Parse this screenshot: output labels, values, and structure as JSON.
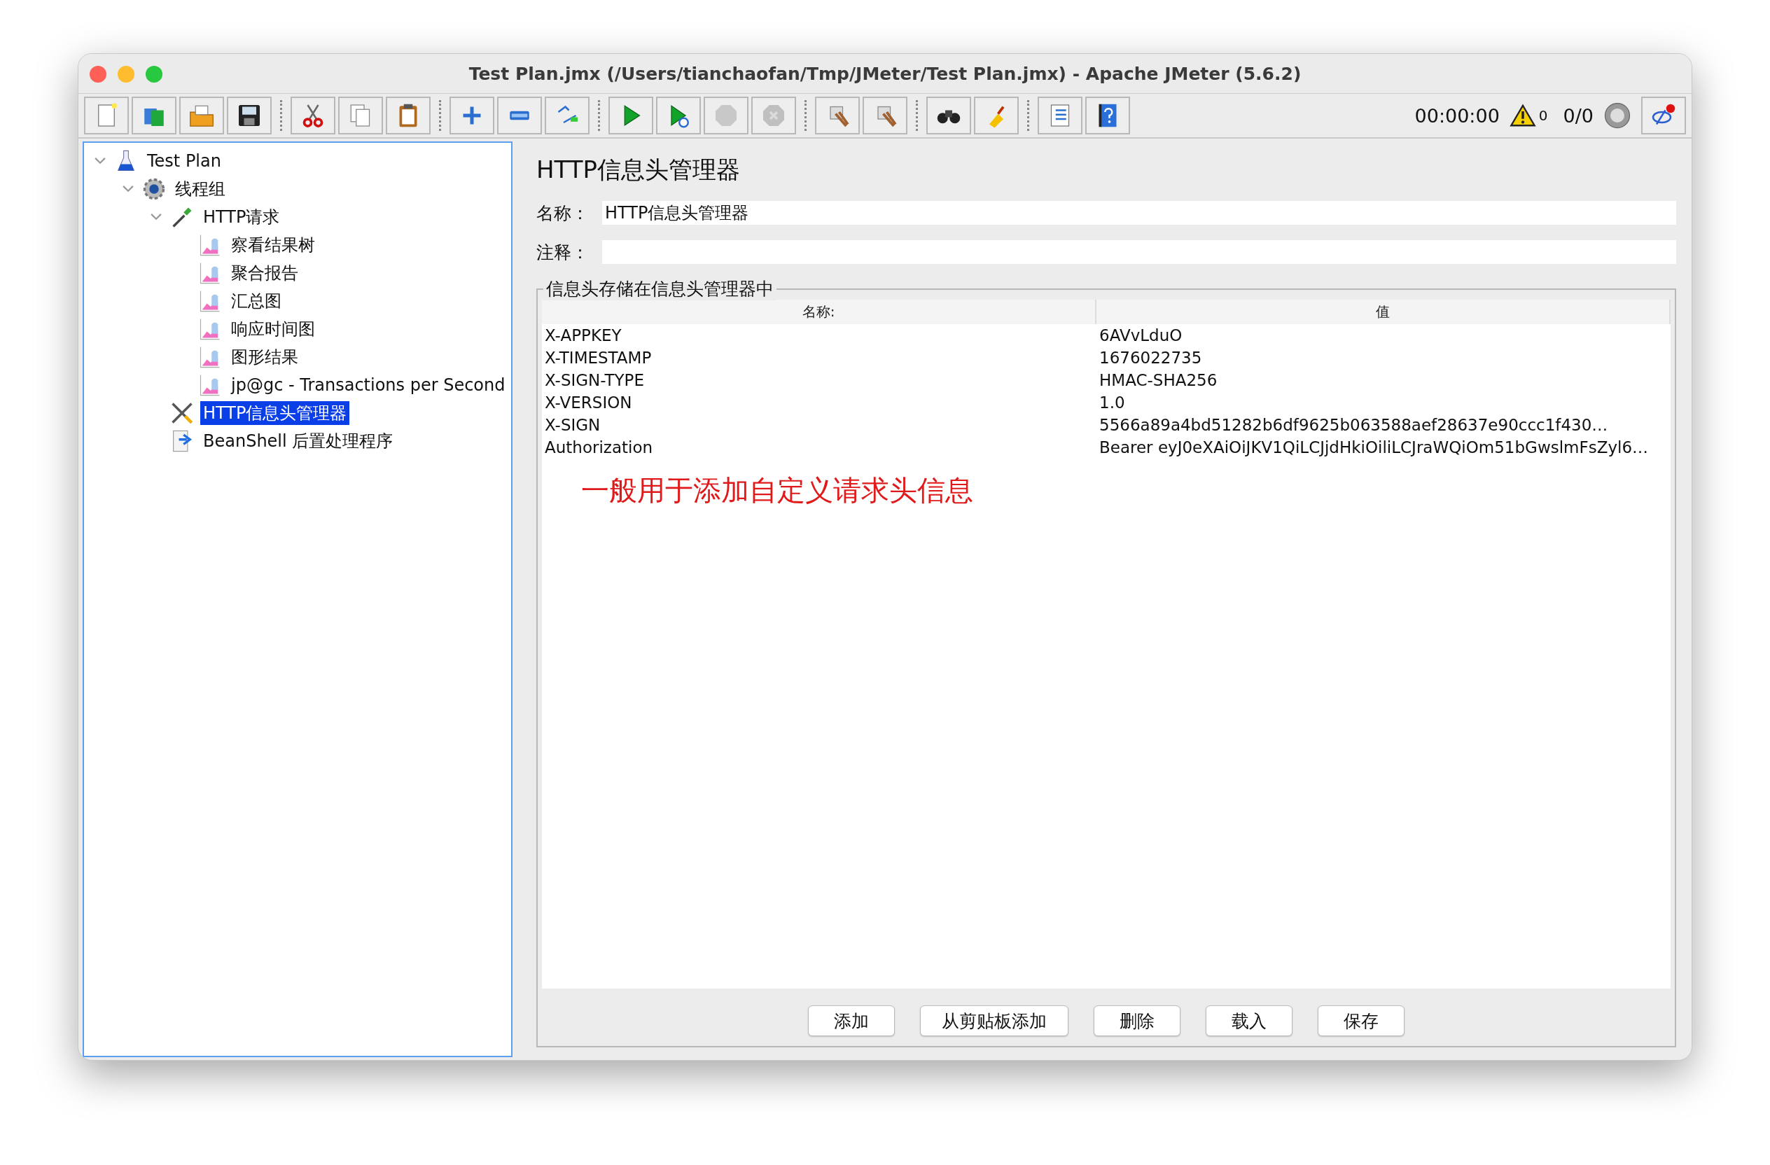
{
  "window": {
    "title": "Test Plan.jmx (/Users/tianchaofan/Tmp/JMeter/Test Plan.jmx) - Apache JMeter (5.6.2)"
  },
  "toolbar": {
    "groups": [
      [
        {
          "kind": "new",
          "disabled": false
        },
        {
          "kind": "templates",
          "disabled": false
        },
        {
          "kind": "open",
          "disabled": false
        },
        {
          "kind": "save",
          "disabled": false
        }
      ],
      [
        {
          "kind": "cut",
          "disabled": false
        },
        {
          "kind": "copy",
          "disabled": false
        },
        {
          "kind": "paste",
          "disabled": false
        }
      ],
      [
        {
          "kind": "expand",
          "disabled": false
        },
        {
          "kind": "collapse",
          "disabled": false
        },
        {
          "kind": "toggle",
          "disabled": false
        }
      ],
      [
        {
          "kind": "start",
          "disabled": false
        },
        {
          "kind": "start-no-timers",
          "disabled": false
        },
        {
          "kind": "stop",
          "disabled": true
        },
        {
          "kind": "shutdown",
          "disabled": true
        }
      ],
      [
        {
          "kind": "clear",
          "disabled": false
        },
        {
          "kind": "clear-all",
          "disabled": false
        }
      ],
      [
        {
          "kind": "search",
          "disabled": false
        },
        {
          "kind": "reset-search",
          "disabled": false
        }
      ],
      [
        {
          "kind": "function-helper",
          "disabled": false
        },
        {
          "kind": "help",
          "disabled": false
        }
      ]
    ],
    "elapsed": "00:00:00",
    "error_count": "0",
    "threads": "0/0"
  },
  "tree": [
    {
      "label": "Test Plan",
      "kind": "test-plan",
      "expanded": true,
      "selected": false,
      "children": [
        {
          "label": "线程组",
          "kind": "thread-group",
          "expanded": true,
          "selected": false,
          "children": [
            {
              "label": "HTTP请求",
              "kind": "sampler",
              "expanded": true,
              "selected": false,
              "children": [
                {
                  "label": "察看结果树",
                  "kind": "listener",
                  "selected": false
                },
                {
                  "label": "聚合报告",
                  "kind": "listener",
                  "selected": false
                },
                {
                  "label": "汇总图",
                  "kind": "listener",
                  "selected": false
                },
                {
                  "label": "响应时间图",
                  "kind": "listener",
                  "selected": false
                },
                {
                  "label": "图形结果",
                  "kind": "listener",
                  "selected": false
                },
                {
                  "label": "jp@gc - Transactions per Second",
                  "kind": "listener",
                  "selected": false
                }
              ]
            },
            {
              "label": "HTTP信息头管理器",
              "kind": "config",
              "selected": true
            },
            {
              "label": "BeanShell 后置处理程序",
              "kind": "postprocessor",
              "selected": false
            }
          ]
        }
      ]
    }
  ],
  "panel": {
    "title": "HTTP信息头管理器",
    "name_label": "名称：",
    "name_value": "HTTP信息头管理器",
    "comment_label": "注释：",
    "group_title": "信息头存储在信息头管理器中",
    "table": {
      "columns": [
        "名称:",
        "值"
      ],
      "rows": [
        [
          "X-APPKEY",
          "6AVvLduO"
        ],
        [
          "X-TIMESTAMP",
          "1676022735"
        ],
        [
          "X-SIGN-TYPE",
          "HMAC-SHA256"
        ],
        [
          "X-VERSION",
          "1.0"
        ],
        [
          "X-SIGN",
          "5566a89a4bd51282b6df9625b063588aef28637e90ccc1f430…"
        ],
        [
          "Authorization",
          "Bearer eyJ0eXAiOiJKV1QiLCJjdHkiOiliLCJraWQiOm51bGwslmFsZyl6…"
        ]
      ]
    },
    "annotation": "一般用于添加自定义请求头信息",
    "buttons": [
      "添加",
      "从剪贴板添加",
      "删除",
      "载入",
      "保存"
    ]
  }
}
